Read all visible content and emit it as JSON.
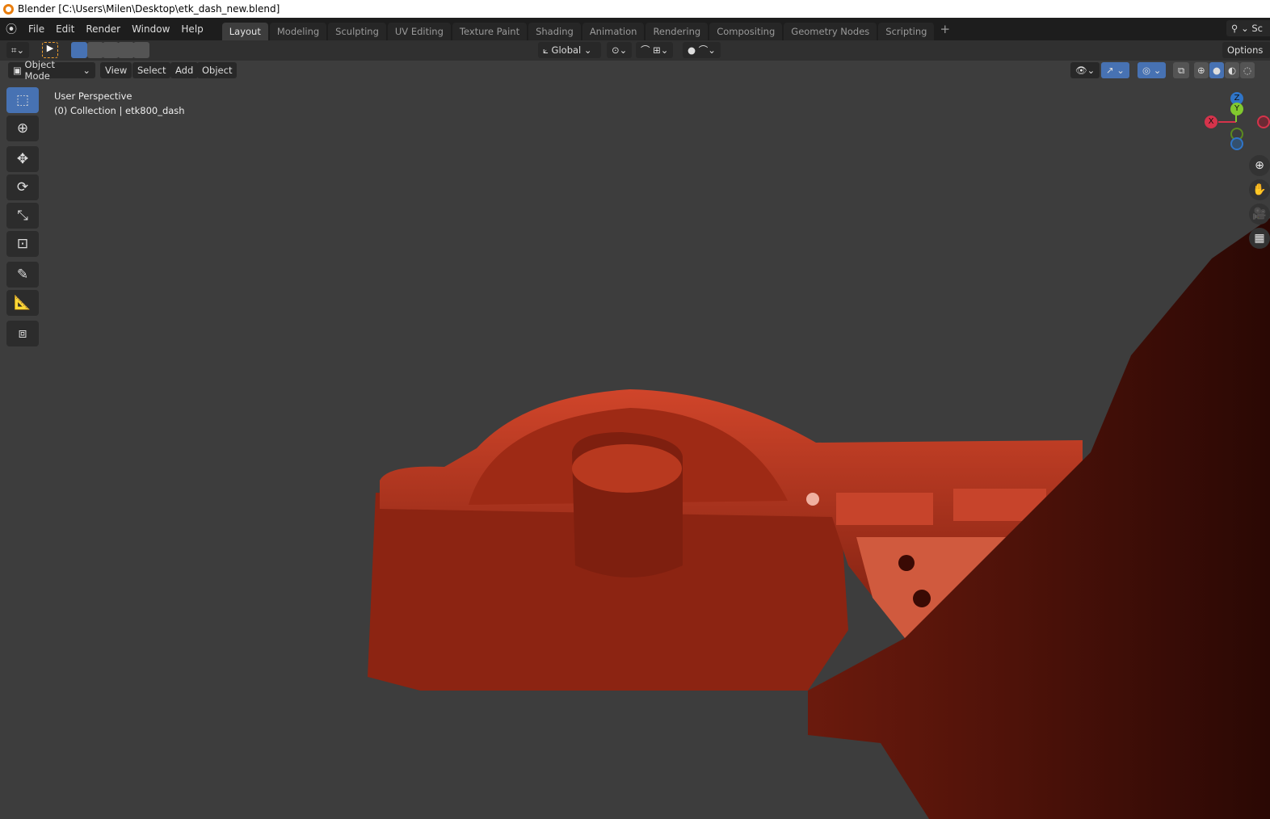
{
  "window_title": "Blender [C:\\Users\\Milen\\Desktop\\etk_dash_new.blend]",
  "menu": [
    "File",
    "Edit",
    "Render",
    "Window",
    "Help"
  ],
  "tabs": [
    "Layout",
    "Modeling",
    "Sculpting",
    "UV Editing",
    "Texture Paint",
    "Shading",
    "Animation",
    "Rendering",
    "Compositing",
    "Geometry Nodes",
    "Scripting"
  ],
  "active_tab": "Layout",
  "scene_label": "Sc",
  "header": {
    "orientation": "Global",
    "options": "Options"
  },
  "viewport_header": {
    "mode": "Object Mode",
    "menus": [
      "View",
      "Select",
      "Add",
      "Object"
    ]
  },
  "viewport": {
    "perspective": "User Perspective",
    "collection": "(0) Collection | etk800_dash"
  },
  "gizmo": {
    "x": "X",
    "y": "Y",
    "z": "Z",
    "x_color": "#d5334b",
    "y_color": "#81c92e",
    "z_color": "#2f75c9"
  },
  "tools": [
    "select-box",
    "cursor",
    "move",
    "rotate",
    "scale",
    "transform",
    "annotate",
    "measure",
    "add-cube"
  ],
  "colors": {
    "accent": "#4772b3",
    "model": "#a52a14"
  }
}
